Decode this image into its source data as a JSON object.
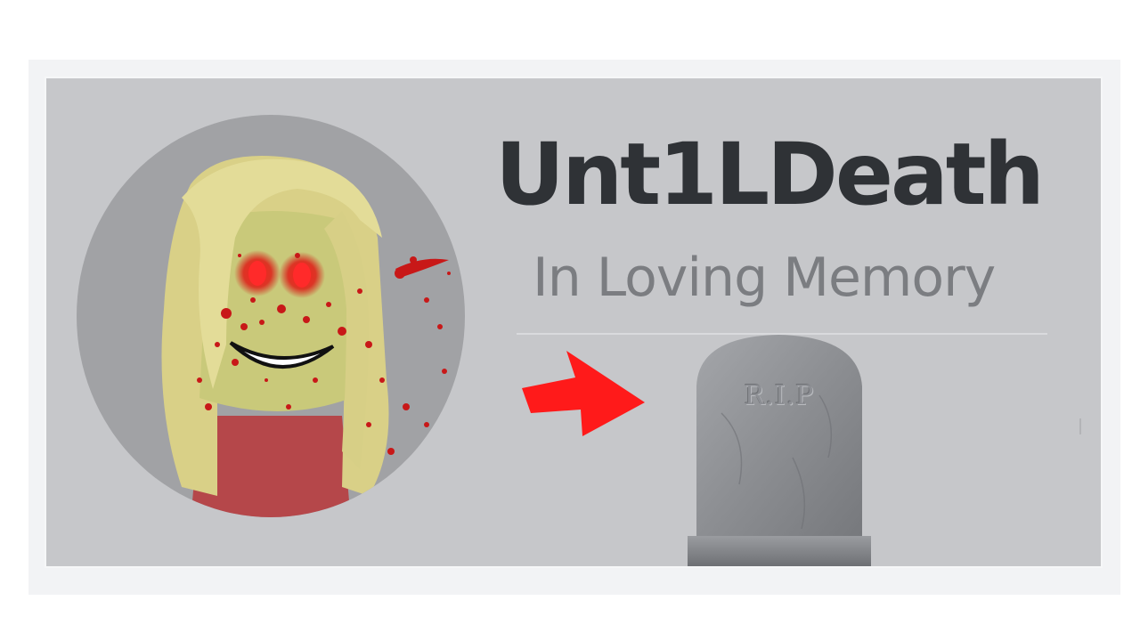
{
  "profile": {
    "username": "Unt1LDeath",
    "subtitle": "In Loving Memory"
  },
  "tombstone": {
    "inscription": "R.I.P"
  },
  "icons": {
    "avatar": "avatar-icon",
    "arrow": "arrow-right-icon",
    "tombstone": "tombstone-icon"
  },
  "colors": {
    "card_background": "#c6c7ca",
    "username": "#2f3236",
    "subtitle": "#7b7d81",
    "arrow": "#ff1a1a",
    "tombstone": "#8e9094"
  }
}
